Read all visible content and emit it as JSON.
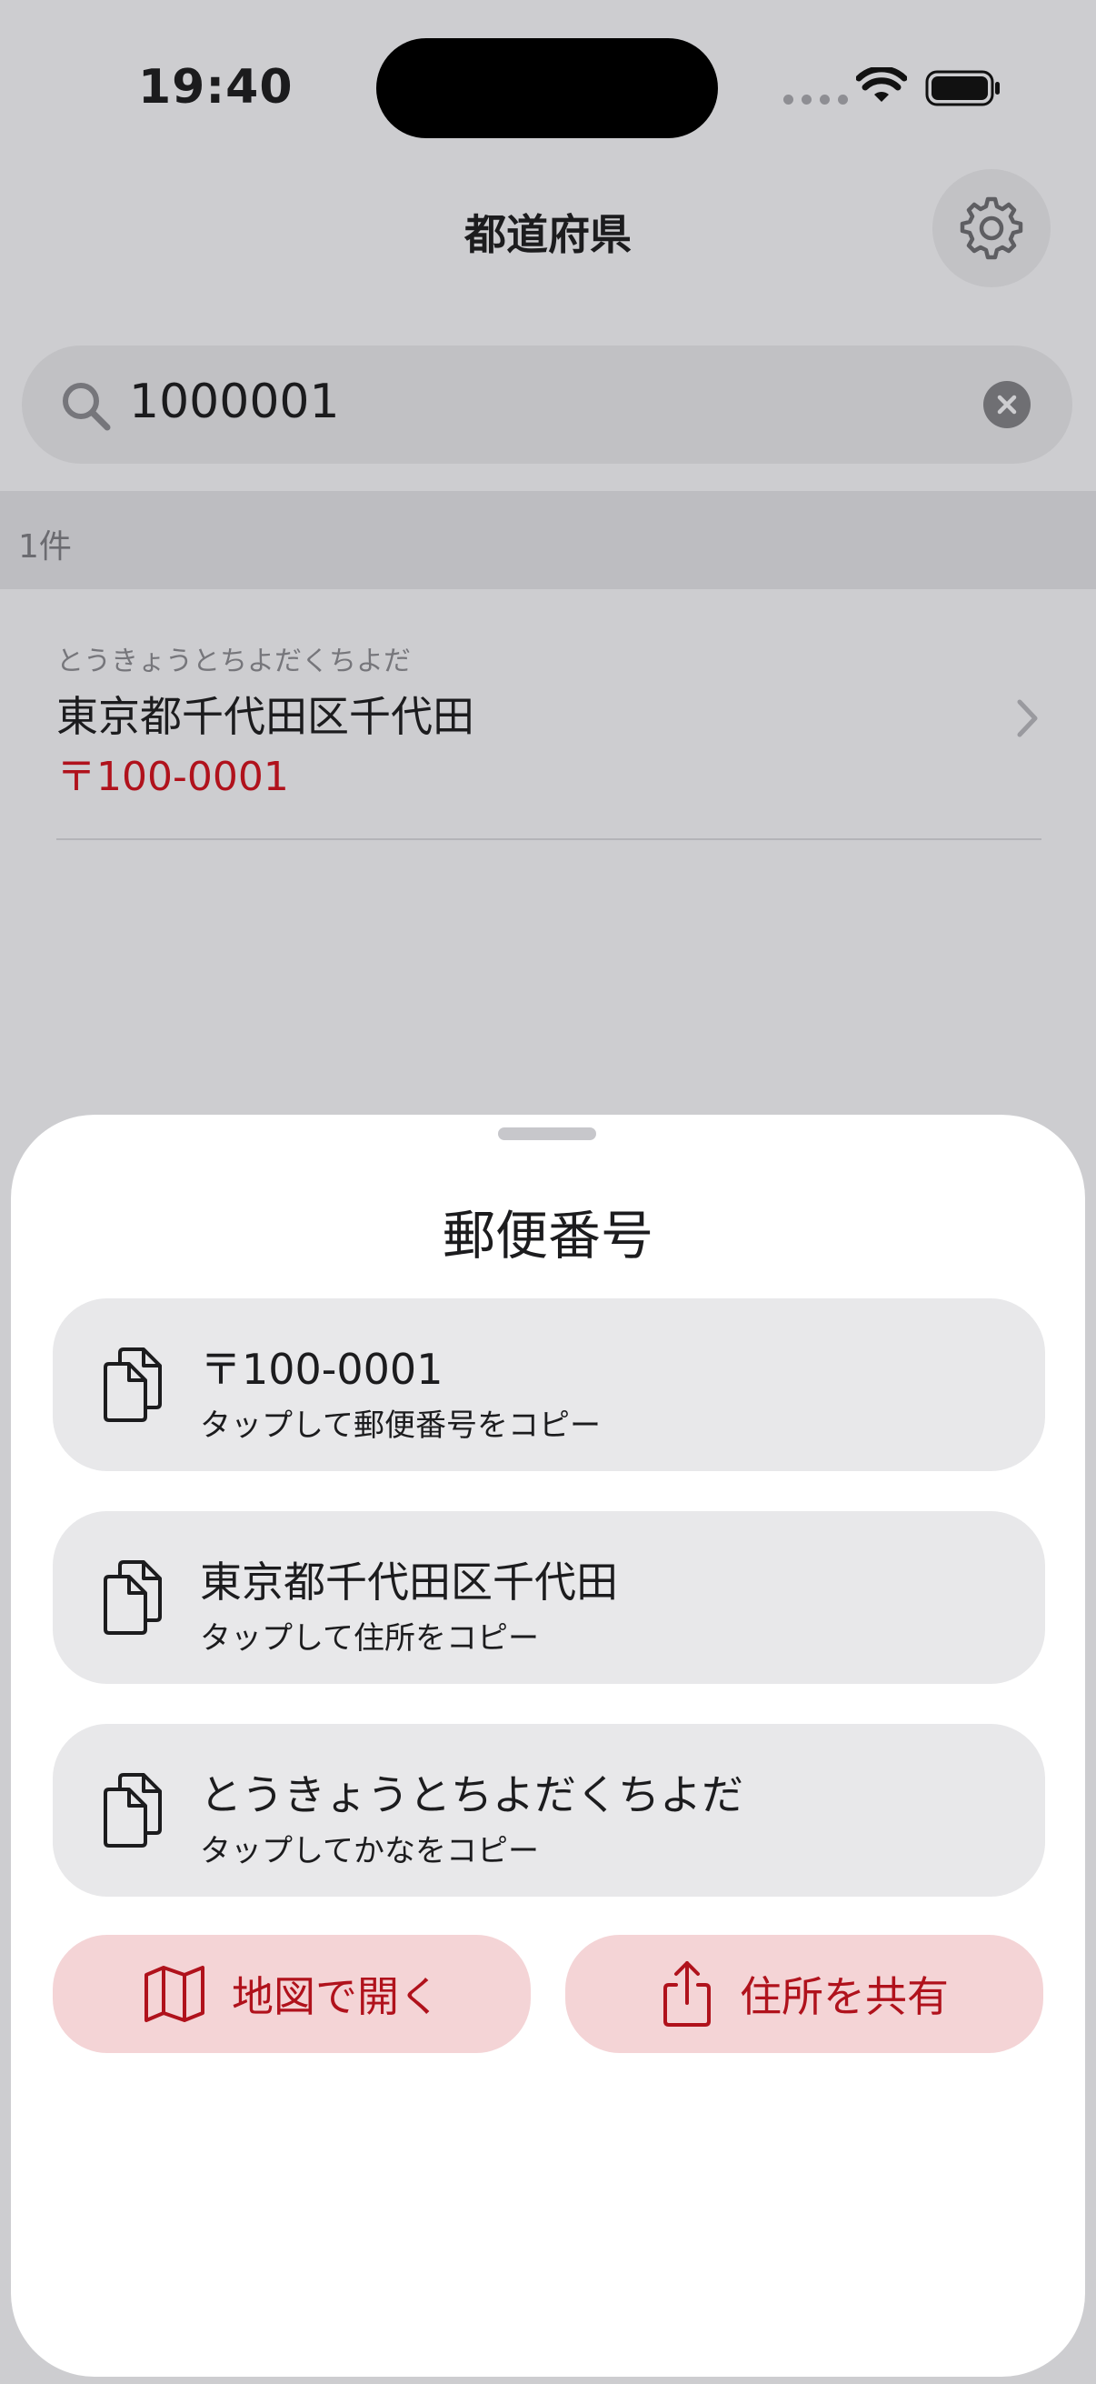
{
  "status_bar": {
    "time": "19:40"
  },
  "nav": {
    "title": "都道府県"
  },
  "search": {
    "value": "1000001"
  },
  "results": {
    "count_label": "1件",
    "rows": [
      {
        "kana": "とうきょうとちよだくちよだ",
        "address": "東京都千代田区千代田",
        "postal": "〒100-0001"
      }
    ]
  },
  "sheet": {
    "title": "郵便番号",
    "cards": [
      {
        "main": "〒100-0001",
        "sub": "タップして郵便番号をコピー",
        "icon": "copy-icon"
      },
      {
        "main": "東京都千代田区千代田",
        "sub": "タップして住所をコピー",
        "icon": "copy-icon"
      },
      {
        "main": "とうきょうとちよだくちよだ",
        "sub": "タップしてかなをコピー",
        "icon": "copy-icon"
      }
    ],
    "actions": {
      "map_label": "地図で開く",
      "share_label": "住所を共有"
    }
  },
  "colors": {
    "accent": "#b0121c",
    "accent_background": "#f4d4d6",
    "dimmed_background": "#cdcdd0",
    "card_background": "#e8e8ea"
  }
}
